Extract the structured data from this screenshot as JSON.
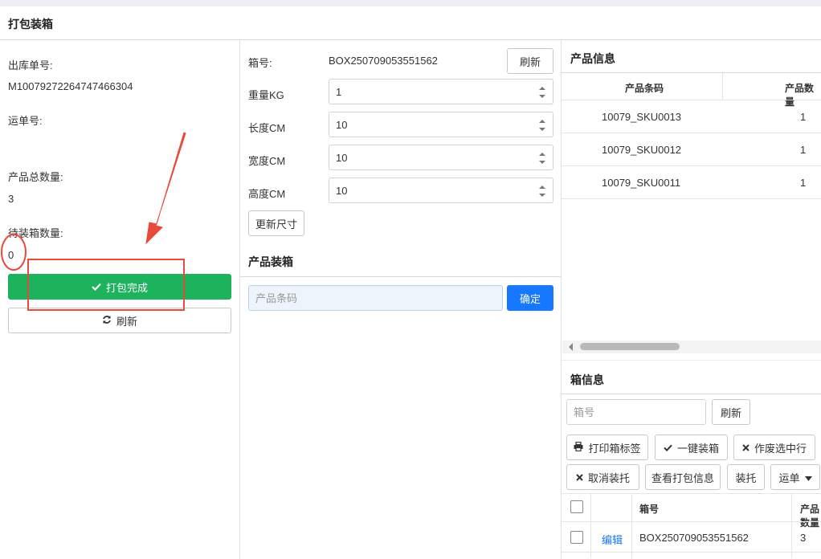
{
  "page": {
    "title": "打包装箱"
  },
  "left": {
    "order_no_label": "出库单号:",
    "order_no_value": "M10079272264747466304",
    "tracking_label": "运单号:",
    "tracking_value": "",
    "total_qty_label": "产品总数量:",
    "total_qty_value": "3",
    "pending_qty_label": "待装箱数量:",
    "pending_qty_value": "0",
    "complete_button": "打包完成",
    "refresh_button": "刷新"
  },
  "middle": {
    "box_no_label": "箱号:",
    "box_no_value": "BOX250709053551562",
    "refresh_button": "刷新",
    "weight_label": "重量KG",
    "weight_value": "1",
    "length_label": "长度CM",
    "length_value": "10",
    "width_label": "宽度CM",
    "width_value": "10",
    "height_label": "高度CM",
    "height_value": "10",
    "update_size_button": "更新尺寸",
    "packing_title": "产品装箱",
    "barcode_placeholder": "产品条码",
    "confirm_button": "确定"
  },
  "product_info": {
    "title": "产品信息",
    "columns": [
      "产品条码",
      "产品数量"
    ],
    "rows": [
      {
        "barcode": "10079_SKU0013",
        "qty": "1"
      },
      {
        "barcode": "10079_SKU0012",
        "qty": "1"
      },
      {
        "barcode": "10079_SKU0011",
        "qty": "1"
      }
    ]
  },
  "box_info": {
    "title": "箱信息",
    "box_no_placeholder": "箱号",
    "refresh_button": "刷新",
    "buttons": {
      "print_label": "打印箱标签",
      "one_click_pack": "一键装箱",
      "void_selected": "作废选中行",
      "cancel_pallet": "取消装托",
      "view_pack_info": "查看打包信息",
      "pallet": "装托",
      "waybill": "运单"
    },
    "columns": [
      "箱号",
      "产品数量"
    ],
    "rows": [
      {
        "action": "编辑",
        "box_no": "BOX250709053551562",
        "qty": "3"
      }
    ]
  },
  "colors": {
    "primary_green": "#1cb35c",
    "primary_blue": "#1677ff",
    "annotation_red": "#e84a3c"
  }
}
